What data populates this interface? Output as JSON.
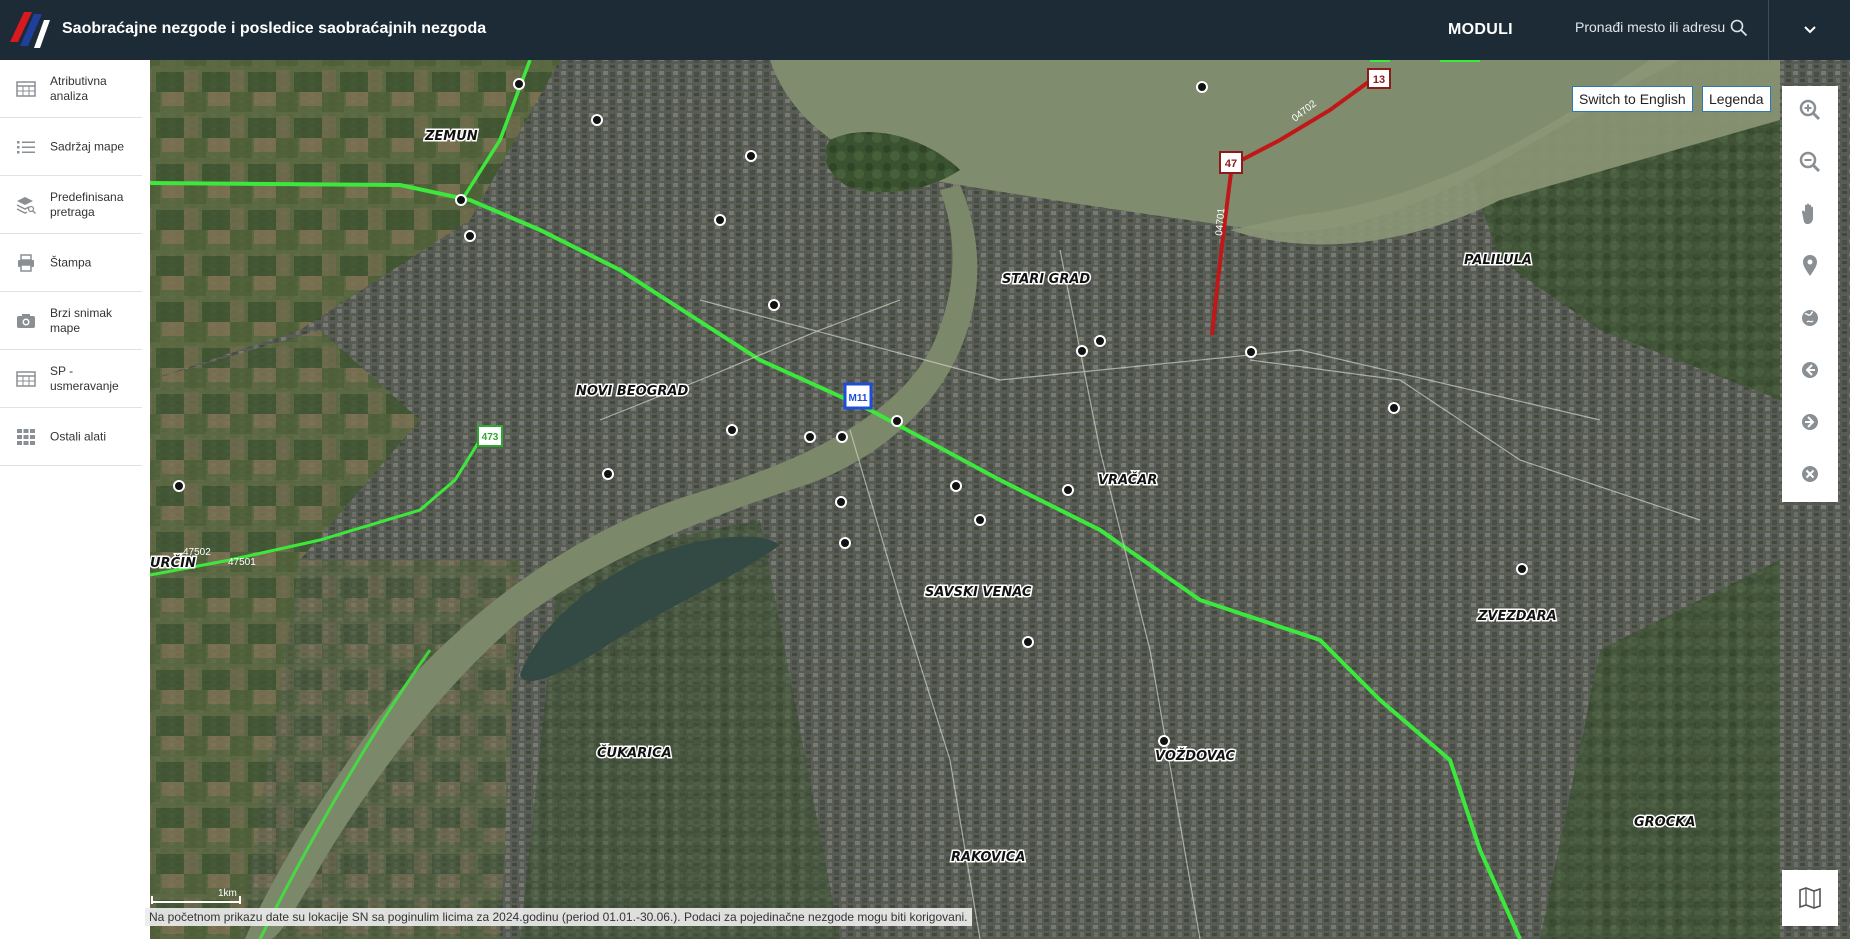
{
  "header": {
    "title": "Saobraćajne nezgode i posledice saobraćajnih nezgoda",
    "modules_label": "MODULI",
    "search_placeholder": "Pronađi mesto ili adresu"
  },
  "sidebar": {
    "items": [
      {
        "label": "Atributivna analiza",
        "icon": "table-icon"
      },
      {
        "label": "Sadržaj mape",
        "icon": "list-icon"
      },
      {
        "label": "Predefinisana pretraga",
        "icon": "layers-search-icon"
      },
      {
        "label": "Štampa",
        "icon": "printer-icon"
      },
      {
        "label": "Brzi snimak mape",
        "icon": "camera-icon"
      },
      {
        "label": "SP - usmeravanje",
        "icon": "table-route-icon"
      },
      {
        "label": "Ostali alati",
        "icon": "grid-icon"
      }
    ]
  },
  "map": {
    "switch_language_label": "Switch to English",
    "legend_label": "Legenda",
    "districts": [
      "ZEMUN",
      "NOVI BEOGRAD",
      "STARI GRAD",
      "PALILULA",
      "VRAČAR",
      "SAVSKI VENAC",
      "ZVEZDARA",
      "ČUKARICA",
      "VOŽDOVAC",
      "RAKOVICA",
      "GROCKA",
      "URČIN"
    ],
    "road_shields": [
      "13",
      "47",
      "M11",
      "473"
    ],
    "road_codes": [
      "04702",
      "04701",
      "47502",
      "47501"
    ],
    "scale_label": "1km",
    "colors": {
      "highway": "#3de83d",
      "state_road": "#c01818",
      "water": "#7f8d6e",
      "header": "#1c2b36"
    },
    "tools": [
      "zoom-in-icon",
      "zoom-out-icon",
      "pan-hand-icon",
      "location-pin-icon",
      "globe-icon",
      "back-arrow-icon",
      "forward-arrow-icon",
      "clear-icon"
    ],
    "basemap_icon": "map-icon"
  },
  "footer": {
    "note": "Na početnom prikazu date su lokacije SN sa poginulim licima za 2024.godinu (period 01.01.-30.06.). Podaci za pojedinačne nezgode mogu biti korigovani."
  }
}
